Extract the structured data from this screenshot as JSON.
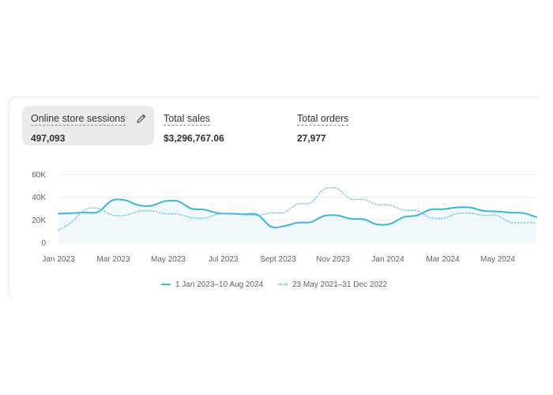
{
  "metrics": [
    {
      "label": "Online store sessions",
      "value": "497,093",
      "selected": true
    },
    {
      "label": "Total sales",
      "value": "$3,296,767.06"
    },
    {
      "label": "Total orders",
      "value": "27,977"
    }
  ],
  "icons": {
    "edit": "pencil-icon"
  },
  "colors": {
    "primary_series": "#3bb4e0",
    "comparison_series": "#6ec3e4",
    "fill": "#e9f6fc",
    "grid": "#ebebeb"
  },
  "chart_data": {
    "type": "line",
    "ylim": [
      0,
      60000
    ],
    "y_ticks": [
      "0",
      "20K",
      "40K",
      "60K"
    ],
    "y_tick_values": [
      0,
      20000,
      40000,
      60000
    ],
    "x_ticks": [
      "Jan 2023",
      "Mar 2023",
      "May 2023",
      "Jul 2023",
      "Sept 2023",
      "Nov 2023",
      "Jan 2024",
      "Mar 2024",
      "May 2024"
    ],
    "grid": true,
    "legend_position": "bottom",
    "series": [
      {
        "name": "1 Jan 2023–10 Aug 2024",
        "style": "solid",
        "values": [
          25500,
          26000,
          26500,
          27000,
          37000,
          37500,
          33000,
          32500,
          36500,
          36500,
          30000,
          29000,
          26000,
          25500,
          25000,
          24500,
          14000,
          14500,
          17500,
          18000,
          23500,
          24000,
          21000,
          20500,
          16000,
          16500,
          22500,
          24000,
          29000,
          29500,
          31000,
          31000,
          28000,
          27500,
          26500,
          26000,
          22500
        ]
      },
      {
        "name": "23 May 2021–31 Dec 2022",
        "style": "dotted",
        "values": [
          11000,
          18000,
          29000,
          30000,
          24500,
          24000,
          27500,
          28000,
          25500,
          25000,
          22000,
          21500,
          25000,
          25000,
          24500,
          24000,
          26000,
          26500,
          34000,
          35000,
          47000,
          47500,
          38500,
          38000,
          33500,
          33000,
          28500,
          28000,
          22000,
          21500,
          25500,
          26000,
          24000,
          24000,
          18000,
          17500,
          17500
        ]
      }
    ]
  },
  "legend": [
    {
      "label": "1 Jan 2023–10 Aug 2024"
    },
    {
      "label": "23 May 2021–31 Dec 2022"
    }
  ]
}
